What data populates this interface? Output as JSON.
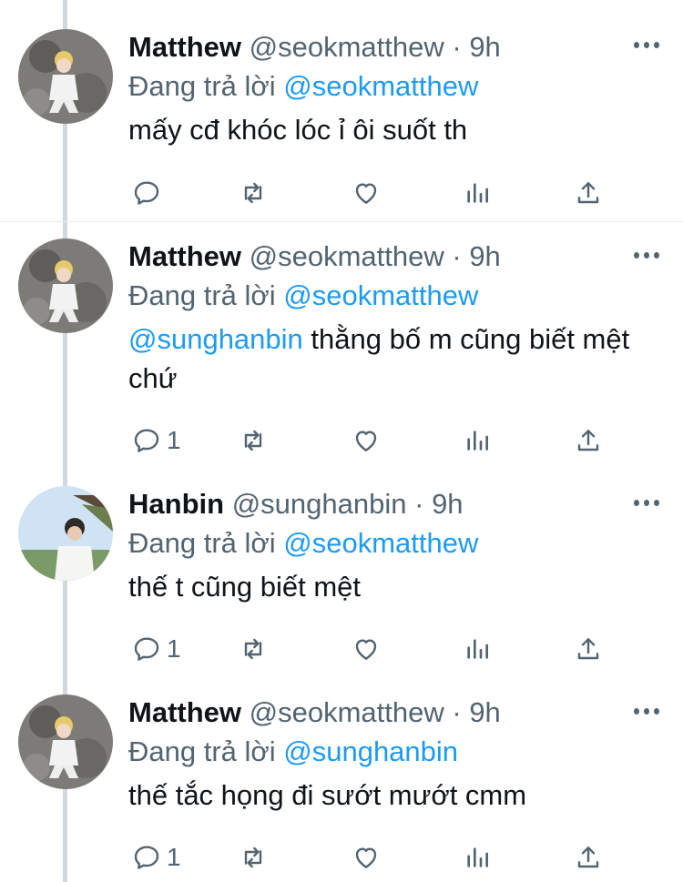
{
  "colors": {
    "accent": "#1d9bf0",
    "secondary_text": "#536471",
    "thread_line": "#cfd9de"
  },
  "tweets": [
    {
      "name": "Matthew",
      "handle": "@seokmatthew",
      "time": "9h",
      "reply_prefix": "Đang trả lời",
      "reply_to": "@seokmatthew",
      "mention": "",
      "text": "mấy cđ khóc lóc ỉ ôi suốt th",
      "reply_count": "",
      "avatar": "avatar-matthew"
    },
    {
      "name": "Matthew",
      "handle": "@seokmatthew",
      "time": "9h",
      "reply_prefix": "Đang trả lời",
      "reply_to": "@seokmatthew",
      "mention": "@sunghanbin",
      "text": " thằng bố m cũng biết mệt chứ",
      "reply_count": "1",
      "avatar": "avatar-matthew"
    },
    {
      "name": "Hanbin",
      "handle": "@sunghanbin",
      "time": "9h",
      "reply_prefix": "Đang trả lời",
      "reply_to": "@seokmatthew",
      "mention": "",
      "text": "thế t cũng biết mệt",
      "reply_count": "1",
      "avatar": "avatar-hanbin"
    },
    {
      "name": "Matthew",
      "handle": "@seokmatthew",
      "time": "9h",
      "reply_prefix": "Đang trả lời",
      "reply_to": "@sunghanbin",
      "mention": "",
      "text": "thế tắc họng đi sướt mướt cmm",
      "reply_count": "1",
      "avatar": "avatar-matthew"
    }
  ],
  "separator": "·",
  "icons": [
    "reply-icon",
    "retweet-icon",
    "like-icon",
    "analytics-icon",
    "share-icon",
    "more-icon"
  ]
}
